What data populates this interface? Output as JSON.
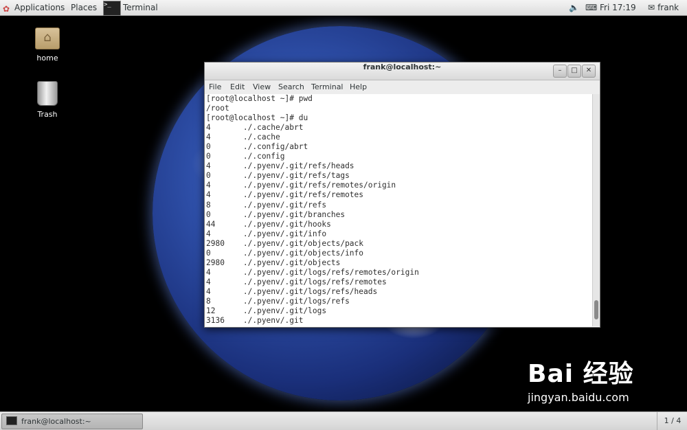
{
  "top_panel": {
    "applications": "Applications",
    "places": "Places",
    "active_app": "Terminal",
    "time": "Fri 17:19",
    "user": "frank"
  },
  "desktop": {
    "icons": [
      {
        "label": "home",
        "icon": "folder-home-icon"
      },
      {
        "label": "Trash",
        "icon": "trash-icon"
      }
    ],
    "watermark": {
      "logo": "Bai 经验",
      "url": "jingyan.baidu.com"
    }
  },
  "terminal": {
    "title": "frank@localhost:~",
    "menu": [
      "File",
      "Edit",
      "View",
      "Search",
      "Terminal",
      "Help"
    ],
    "lines": [
      "[root@localhost ~]# pwd",
      "/root",
      "[root@localhost ~]# du",
      "4       ./.cache/abrt",
      "4       ./.cache",
      "0       ./.config/abrt",
      "0       ./.config",
      "4       ./.pyenv/.git/refs/heads",
      "0       ./.pyenv/.git/refs/tags",
      "4       ./.pyenv/.git/refs/remotes/origin",
      "4       ./.pyenv/.git/refs/remotes",
      "8       ./.pyenv/.git/refs",
      "0       ./.pyenv/.git/branches",
      "44      ./.pyenv/.git/hooks",
      "4       ./.pyenv/.git/info",
      "2980    ./.pyenv/.git/objects/pack",
      "0       ./.pyenv/.git/objects/info",
      "2980    ./.pyenv/.git/objects",
      "4       ./.pyenv/.git/logs/refs/remotes/origin",
      "4       ./.pyenv/.git/logs/refs/remotes",
      "4       ./.pyenv/.git/logs/refs/heads",
      "8       ./.pyenv/.git/logs/refs",
      "12      ./.pyenv/.git/logs",
      "3136    ./.pyenv/.git"
    ]
  },
  "bottom_panel": {
    "task_label": "frank@localhost:~",
    "workspace": "1 / 4"
  }
}
